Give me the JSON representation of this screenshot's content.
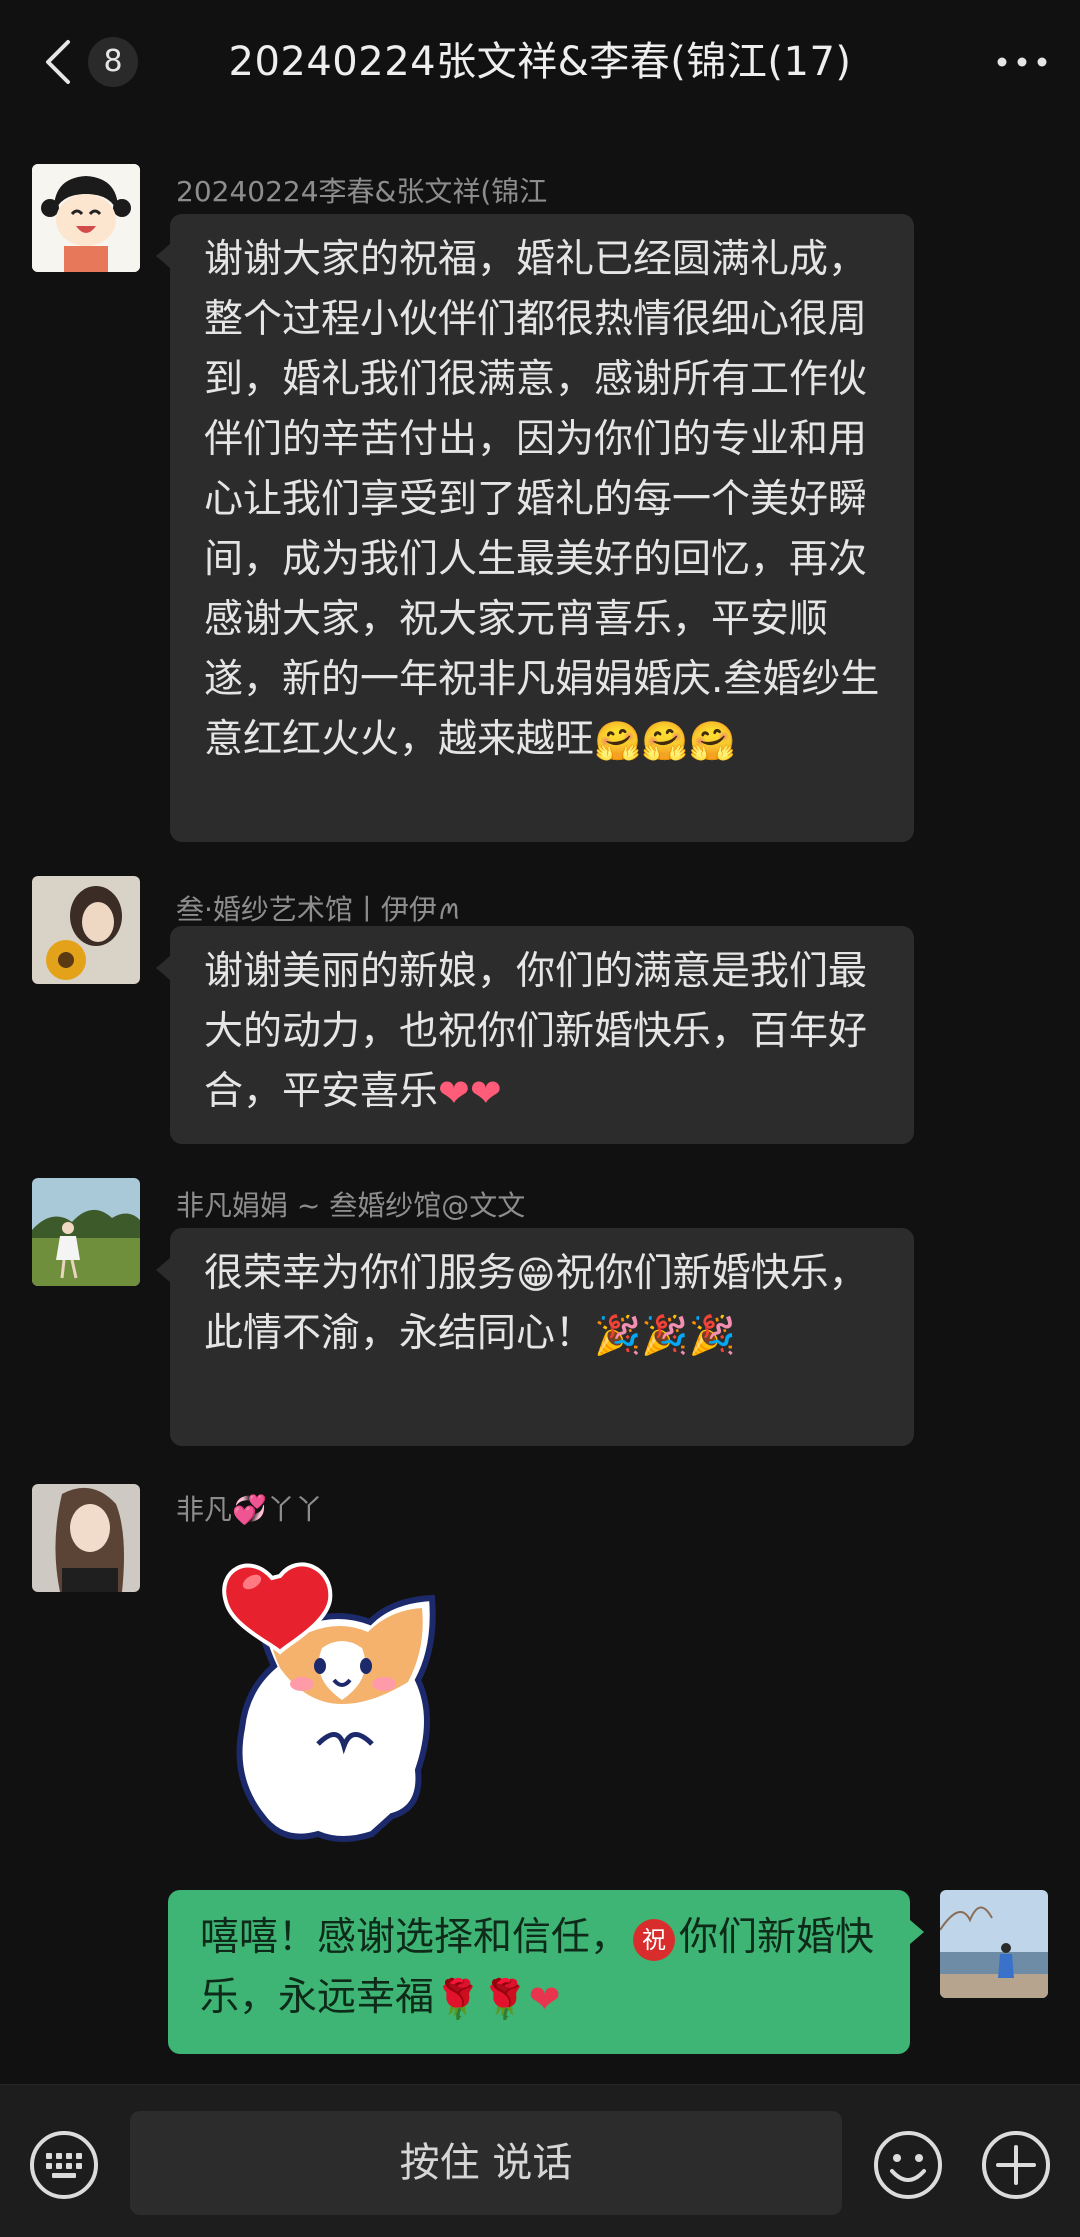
{
  "header": {
    "unread_count": "8",
    "title": "20240224张文祥&李春(锦江(17)"
  },
  "messages": [
    {
      "sender": "20240224李春&张文祥(锦江",
      "text": "谢谢大家的祝福，婚礼已经圆满礼成，整个过程小伙伴们都很热情很细心很周到，婚礼我们很满意，感谢所有工作伙伴们的辛苦付出，因为你们的专业和用心让我们享受到了婚礼的每一个美好瞬间，成为我们人生最美好的回忆，再次感谢大家，祝大家元宵喜乐，平安顺遂，新的一年祝非凡娟娟婚庆.叁婚纱生意红红火火，越来越旺",
      "emojis": "🤗🤗🤗"
    },
    {
      "sender": "叁·婚纱艺术馆丨伊伊ꪔ",
      "text": "谢谢美丽的新娘，你们的满意是我们最大的动力，也祝你们新婚快乐，百年好合，平安喜乐",
      "emojis": "❤❤"
    },
    {
      "sender": "非凡娟娟 ~ 叁婚纱馆@文文",
      "text_a": "很荣幸为你们服务",
      "emoji_a": "😁",
      "text_b": "祝你们新婚快乐，此情不渝，永结同心！",
      "emojis": "🎉🎉🎉"
    },
    {
      "sender_a": "非凡",
      "sender_emoji": "💞",
      "sender_b": "丫丫"
    }
  ],
  "my_message": {
    "text_a": "嘻嘻！感谢选择和信任，",
    "badge": "祝",
    "text_b": "你们新婚快乐，永远幸福",
    "emojis": "🌹🌹❤"
  },
  "input_bar": {
    "hold_to_talk": "按住 说话"
  }
}
